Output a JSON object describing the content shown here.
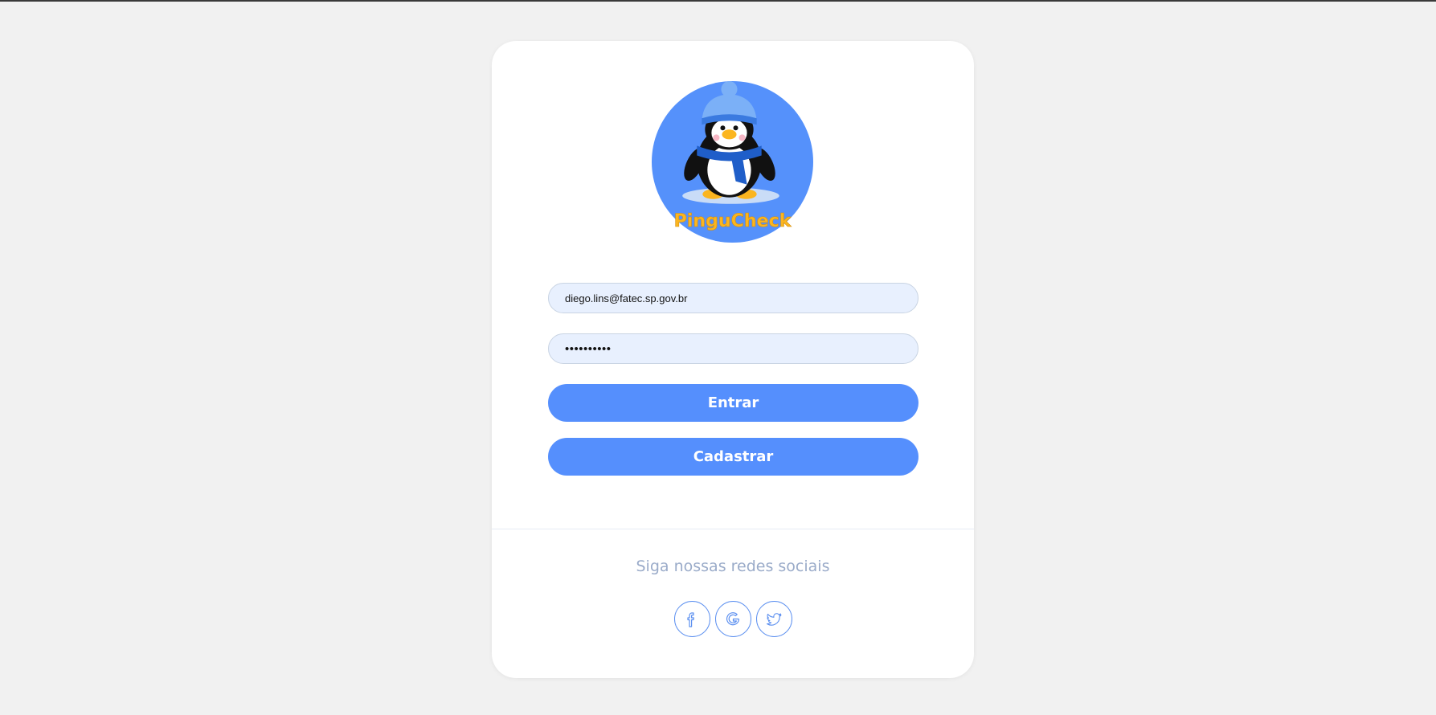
{
  "brand": {
    "name": "PinguCheck",
    "logo_bg_color": "#5591fb",
    "logo_text_color": "#fbb51f"
  },
  "login_form": {
    "email_value": "diego.lins@fatec.sp.gov.br",
    "password_value": "••••••••••",
    "login_label": "Entrar",
    "signup_label": "Cadastrar"
  },
  "social": {
    "title": "Siga nossas redes sociais",
    "links": [
      {
        "icon": "facebook-icon"
      },
      {
        "icon": "google-icon"
      },
      {
        "icon": "twitter-icon"
      }
    ]
  },
  "colors": {
    "primary": "#558ffd",
    "field_bg": "#e8f0fe",
    "page_bg": "#f1f1f1",
    "social_title": "#9aabc9"
  }
}
